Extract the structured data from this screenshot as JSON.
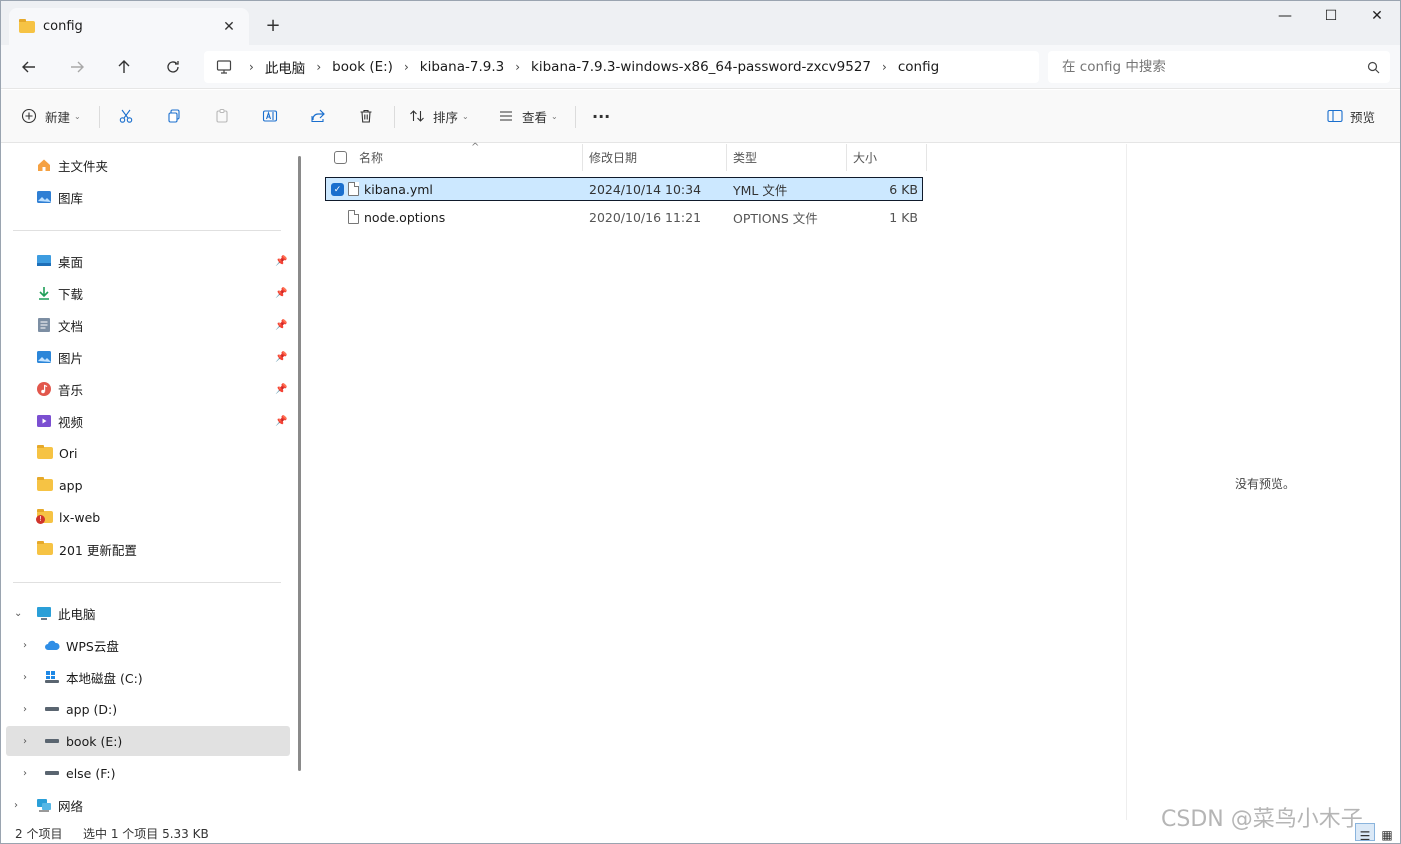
{
  "window": {
    "tab_title": "config",
    "tab_close": "✕",
    "new_tab": "+",
    "minimize": "—",
    "maximize": "☐",
    "close": "✕"
  },
  "address": {
    "crumbs": [
      "此电脑",
      "book (E:)",
      "kibana-7.9.3",
      "kibana-7.9.3-windows-x86_64-password-zxcv9527",
      "config"
    ],
    "search_placeholder": "在 config 中搜索"
  },
  "toolbar": {
    "new_label": "新建",
    "sort_label": "排序",
    "view_label": "查看",
    "more_label": "···",
    "preview_label": "预览"
  },
  "sidebar": {
    "quick": [
      {
        "label": "主文件夹",
        "icon": "home-icon"
      },
      {
        "label": "图库",
        "icon": "gallery-icon"
      }
    ],
    "pinned": [
      {
        "label": "桌面",
        "icon": "desktop-icon"
      },
      {
        "label": "下载",
        "icon": "download-icon"
      },
      {
        "label": "文档",
        "icon": "document-icon"
      },
      {
        "label": "图片",
        "icon": "picture-icon"
      },
      {
        "label": "音乐",
        "icon": "music-icon"
      },
      {
        "label": "视频",
        "icon": "video-icon"
      }
    ],
    "folders": [
      {
        "label": "Ori",
        "icon": "folder-icon"
      },
      {
        "label": "app",
        "icon": "folder-icon"
      },
      {
        "label": "lx-web",
        "icon": "folder-alert-icon"
      },
      {
        "label": "201 更新配置",
        "icon": "folder-icon"
      }
    ],
    "pc_label": "此电脑",
    "drives": [
      {
        "label": "WPS云盘",
        "icon": "cloud-icon"
      },
      {
        "label": "本地磁盘 (C:)",
        "icon": "windows-drive-icon"
      },
      {
        "label": "app (D:)",
        "icon": "drive-icon"
      },
      {
        "label": "book (E:)",
        "icon": "drive-icon"
      },
      {
        "label": "else (F:)",
        "icon": "drive-icon"
      }
    ],
    "network_label": "网络"
  },
  "files": {
    "columns": [
      "名称",
      "修改日期",
      "类型",
      "大小"
    ],
    "rows": [
      {
        "name": "kibana.yml",
        "date": "2024/10/14 10:34",
        "type": "YML 文件",
        "size": "6 KB",
        "selected": true
      },
      {
        "name": "node.options",
        "date": "2020/10/16 11:21",
        "type": "OPTIONS 文件",
        "size": "1 KB",
        "selected": false
      }
    ]
  },
  "preview": {
    "message": "没有预览。"
  },
  "status": {
    "item_count": "2 个项目",
    "selection": "选中 1 个项目  5.33 KB"
  },
  "watermark": "CSDN @菜鸟小木子",
  "colors": {
    "selection_bg": "#cce8ff",
    "accent": "#1a6fce",
    "folder": "#f6c344"
  }
}
